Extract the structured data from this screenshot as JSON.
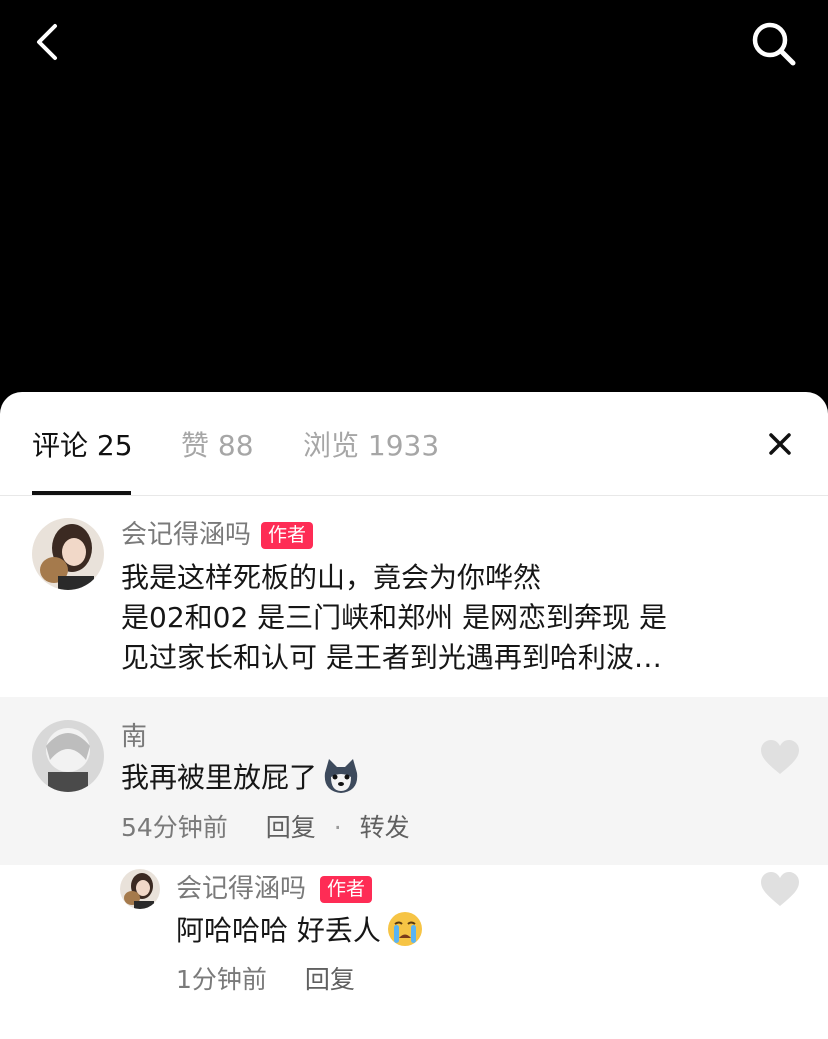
{
  "header": {
    "back_icon": "chevron-left-icon",
    "search_icon": "search-icon"
  },
  "tabs": [
    {
      "label": "评论 25",
      "active": true
    },
    {
      "label": "赞 88",
      "active": false
    },
    {
      "label": "浏览 1933",
      "active": false
    }
  ],
  "close_icon": "close-icon",
  "comments": [
    {
      "username": "会记得涵吗",
      "badge": "作者",
      "lines": [
        "我是这样死板的山，竟会为你哗然",
        "是02和02 是三门峡和郑州 是网恋到奔现 是",
        "见过家长和认可 是王者到光遇再到哈利波…"
      ]
    },
    {
      "username": "南",
      "text": "我再被里放屁了",
      "emoji": "husky-emoji",
      "time": "54分钟前",
      "reply_label": "回复",
      "separator": "·",
      "share_label": "转发",
      "like_icon": "heart-icon"
    },
    {
      "username": "会记得涵吗",
      "badge": "作者",
      "text": "阿哈哈哈 好丢人",
      "emoji": "crying-face-emoji",
      "time": "1分钟前",
      "reply_label": "回复",
      "like_icon": "heart-icon"
    }
  ],
  "colors": {
    "background_top": "#000000",
    "sheet": "#ffffff",
    "badge": "#fe2c55",
    "secondary_text": "#7a7a7a",
    "like_gray": "#e0e0e0"
  }
}
